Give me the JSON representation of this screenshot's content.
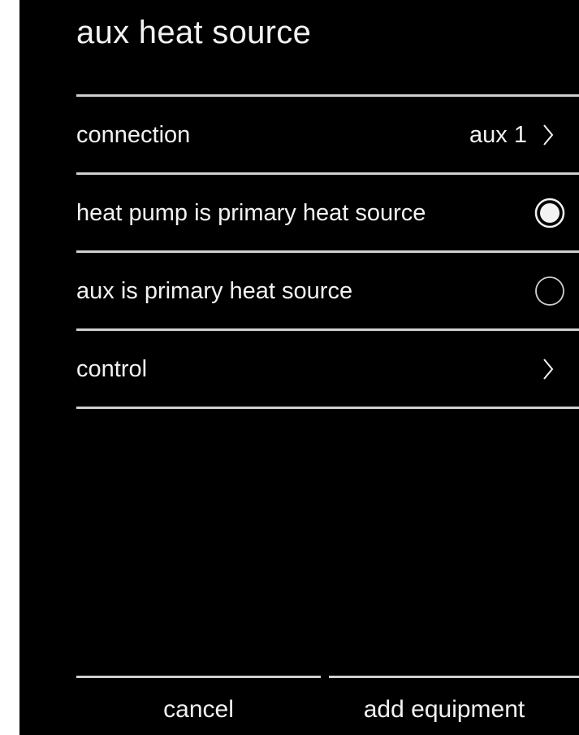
{
  "header": {
    "title": "aux heat source"
  },
  "settings": {
    "items": [
      {
        "label": "connection",
        "value": "aux 1",
        "control": "chevron"
      },
      {
        "label": "heat pump is primary heat source",
        "control": "radio",
        "selected": true
      },
      {
        "label": "aux is primary heat source",
        "control": "radio",
        "selected": false
      },
      {
        "label": "control",
        "control": "chevron"
      }
    ]
  },
  "footer": {
    "cancel_label": "cancel",
    "add_label": "add equipment"
  },
  "colors": {
    "background": "#000000",
    "text": "#f2f2f2",
    "divider": "#cfcfcf",
    "frame": "#ffffff"
  },
  "icons": {
    "chevron": "chevron-right-icon",
    "radio_on": "radio-selected-icon",
    "radio_off": "radio-unselected-icon"
  }
}
